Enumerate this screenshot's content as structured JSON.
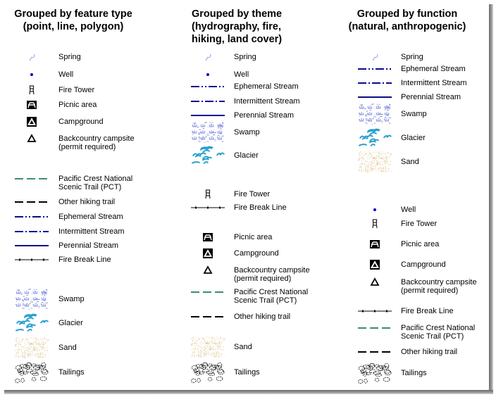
{
  "columns": [
    {
      "title_line1": "Grouped by feature type",
      "title_line2": "(point, line, polygon)",
      "items": [
        {
          "icon": "spring-icon",
          "label": "Spring"
        },
        {
          "icon": "well-icon",
          "label": "Well"
        },
        {
          "icon": "fire-tower-icon",
          "label": "Fire Tower"
        },
        {
          "icon": "picnic-area-icon",
          "label": "Picnic area"
        },
        {
          "icon": "campground-icon",
          "label": "Campground"
        },
        {
          "icon": "backcountry-campsite-icon",
          "label": "Backcountry campsite",
          "label2": "(permit required)"
        },
        {
          "icon": "pct-trail-line-icon",
          "label": "Pacific Crest National",
          "label2": "Scenic Trail (PCT)"
        },
        {
          "icon": "hiking-trail-line-icon",
          "label": "Other hiking trail"
        },
        {
          "icon": "ephemeral-stream-line-icon",
          "label": "Ephemeral Stream"
        },
        {
          "icon": "intermittent-stream-line-icon",
          "label": "Intermittent Stream"
        },
        {
          "icon": "perennial-stream-line-icon",
          "label": "Perennial Stream"
        },
        {
          "icon": "fire-break-line-icon",
          "label": "Fire Break Line"
        },
        {
          "icon": "swamp-pattern-icon",
          "label": "Swamp"
        },
        {
          "icon": "glacier-pattern-icon",
          "label": "Glacier"
        },
        {
          "icon": "sand-pattern-icon",
          "label": "Sand"
        },
        {
          "icon": "tailings-pattern-icon",
          "label": "Tailings"
        }
      ]
    },
    {
      "title_line1": "Grouped by theme",
      "title_line2": "(hydrography, fire,",
      "title_line3": "hiking, land cover)",
      "items": [
        {
          "icon": "spring-icon",
          "label": "Spring"
        },
        {
          "icon": "well-icon",
          "label": "Well"
        },
        {
          "icon": "ephemeral-stream-line-icon",
          "label": "Ephemeral Stream"
        },
        {
          "icon": "intermittent-stream-line-icon",
          "label": "Intermittent Stream"
        },
        {
          "icon": "perennial-stream-line-icon",
          "label": "Perennial Stream"
        },
        {
          "icon": "swamp-pattern-icon",
          "label": "Swamp"
        },
        {
          "icon": "glacier-pattern-icon",
          "label": "Glacier"
        },
        {
          "icon": "fire-tower-icon",
          "label": "Fire Tower"
        },
        {
          "icon": "fire-break-line-icon",
          "label": "Fire Break Line"
        },
        {
          "icon": "picnic-area-icon",
          "label": "Picnic area"
        },
        {
          "icon": "campground-icon",
          "label": "Campground"
        },
        {
          "icon": "backcountry-campsite-icon",
          "label": "Backcountry campsite",
          "label2": "(permit required)"
        },
        {
          "icon": "pct-trail-line-icon",
          "label": "Pacific Crest National",
          "label2": "Scenic Trail (PCT)"
        },
        {
          "icon": "hiking-trail-line-icon",
          "label": "Other hiking trail"
        },
        {
          "icon": "sand-pattern-icon",
          "label": "Sand"
        },
        {
          "icon": "tailings-pattern-icon",
          "label": "Tailings"
        }
      ]
    },
    {
      "title_line1": "Grouped by function",
      "title_line2": "(natural, anthropogenic)",
      "items": [
        {
          "icon": "spring-icon",
          "label": "Spring"
        },
        {
          "icon": "ephemeral-stream-line-icon",
          "label": "Ephemeral Stream"
        },
        {
          "icon": "intermittent-stream-line-icon",
          "label": "Intermittent Stream"
        },
        {
          "icon": "perennial-stream-line-icon",
          "label": "Perennial Stream"
        },
        {
          "icon": "swamp-pattern-icon",
          "label": "Swamp"
        },
        {
          "icon": "glacier-pattern-icon",
          "label": "Glacier"
        },
        {
          "icon": "sand-pattern-icon",
          "label": "Sand"
        },
        {
          "icon": "well-icon",
          "label": "Well"
        },
        {
          "icon": "fire-tower-icon",
          "label": "Fire Tower"
        },
        {
          "icon": "picnic-area-icon",
          "label": "Picnic area"
        },
        {
          "icon": "campground-icon",
          "label": "Campground"
        },
        {
          "icon": "backcountry-campsite-icon",
          "label": "Backcountry campsite",
          "label2": "(permit required)"
        },
        {
          "icon": "fire-break-line-icon",
          "label": "Fire Break Line"
        },
        {
          "icon": "pct-trail-line-icon",
          "label": "Pacific Crest National",
          "label2": "Scenic Trail (PCT)"
        },
        {
          "icon": "hiking-trail-line-icon",
          "label": "Other hiking trail"
        },
        {
          "icon": "tailings-pattern-icon",
          "label": "Tailings"
        }
      ]
    }
  ],
  "colors": {
    "stream": "#0a0a8c",
    "stream_bright": "#0000cc",
    "pct": "#3a8f6a",
    "spring": "#9a9ae0",
    "well": "#0000cc",
    "swamp": "#6a7ad8",
    "glacier": "#2aa0d0",
    "sand": "#d8b878",
    "black": "#000000"
  }
}
